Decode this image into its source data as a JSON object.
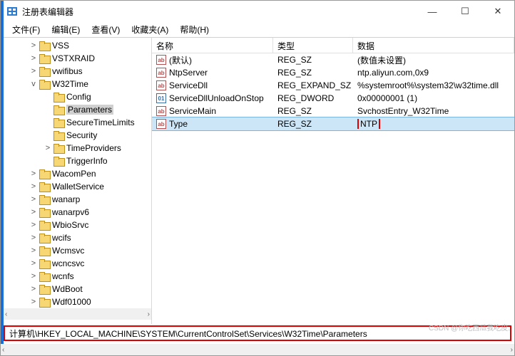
{
  "window": {
    "title": "注册表编辑器"
  },
  "menus": [
    "文件(F)",
    "编辑(E)",
    "查看(V)",
    "收藏夹(A)",
    "帮助(H)"
  ],
  "tree": [
    {
      "indent": 36,
      "twist": ">",
      "label": "VSS"
    },
    {
      "indent": 36,
      "twist": ">",
      "label": "VSTXRAID"
    },
    {
      "indent": 36,
      "twist": ">",
      "label": "vwifibus"
    },
    {
      "indent": 36,
      "twist": "v",
      "label": "W32Time"
    },
    {
      "indent": 56,
      "twist": "",
      "label": "Config"
    },
    {
      "indent": 56,
      "twist": "",
      "label": "Parameters",
      "selected": true
    },
    {
      "indent": 56,
      "twist": "",
      "label": "SecureTimeLimits"
    },
    {
      "indent": 56,
      "twist": "",
      "label": "Security"
    },
    {
      "indent": 56,
      "twist": ">",
      "label": "TimeProviders"
    },
    {
      "indent": 56,
      "twist": "",
      "label": "TriggerInfo"
    },
    {
      "indent": 36,
      "twist": ">",
      "label": "WacomPen"
    },
    {
      "indent": 36,
      "twist": ">",
      "label": "WalletService"
    },
    {
      "indent": 36,
      "twist": ">",
      "label": "wanarp"
    },
    {
      "indent": 36,
      "twist": ">",
      "label": "wanarpv6"
    },
    {
      "indent": 36,
      "twist": ">",
      "label": "WbioSrvc"
    },
    {
      "indent": 36,
      "twist": ">",
      "label": "wcifs"
    },
    {
      "indent": 36,
      "twist": ">",
      "label": "Wcmsvc"
    },
    {
      "indent": 36,
      "twist": ">",
      "label": "wcncsvc"
    },
    {
      "indent": 36,
      "twist": ">",
      "label": "wcnfs"
    },
    {
      "indent": 36,
      "twist": ">",
      "label": "WdBoot"
    },
    {
      "indent": 36,
      "twist": ">",
      "label": "Wdf01000"
    }
  ],
  "columns": {
    "name": "名称",
    "type": "类型",
    "data": "数据"
  },
  "rows": [
    {
      "icon": "str",
      "name": "(默认)",
      "type": "REG_SZ",
      "data": "(数值未设置)"
    },
    {
      "icon": "str",
      "name": "NtpServer",
      "type": "REG_SZ",
      "data": "ntp.aliyun.com,0x9"
    },
    {
      "icon": "str",
      "name": "ServiceDll",
      "type": "REG_EXPAND_SZ",
      "data": "%systemroot%\\system32\\w32time.dll"
    },
    {
      "icon": "bin",
      "name": "ServiceDllUnloadOnStop",
      "type": "REG_DWORD",
      "data": "0x00000001 (1)"
    },
    {
      "icon": "str",
      "name": "ServiceMain",
      "type": "REG_SZ",
      "data": "SvchostEntry_W32Time"
    },
    {
      "icon": "str",
      "name": "Type",
      "type": "REG_SZ",
      "data": "NTP",
      "selected": true,
      "hlData": true
    }
  ],
  "statusbar": "计算机\\HKEY_LOCAL_MACHINE\\SYSTEM\\CurrentControlSet\\Services\\W32Time\\Parameters",
  "watermark": "CSDN @你吃西瓜我吃皮."
}
